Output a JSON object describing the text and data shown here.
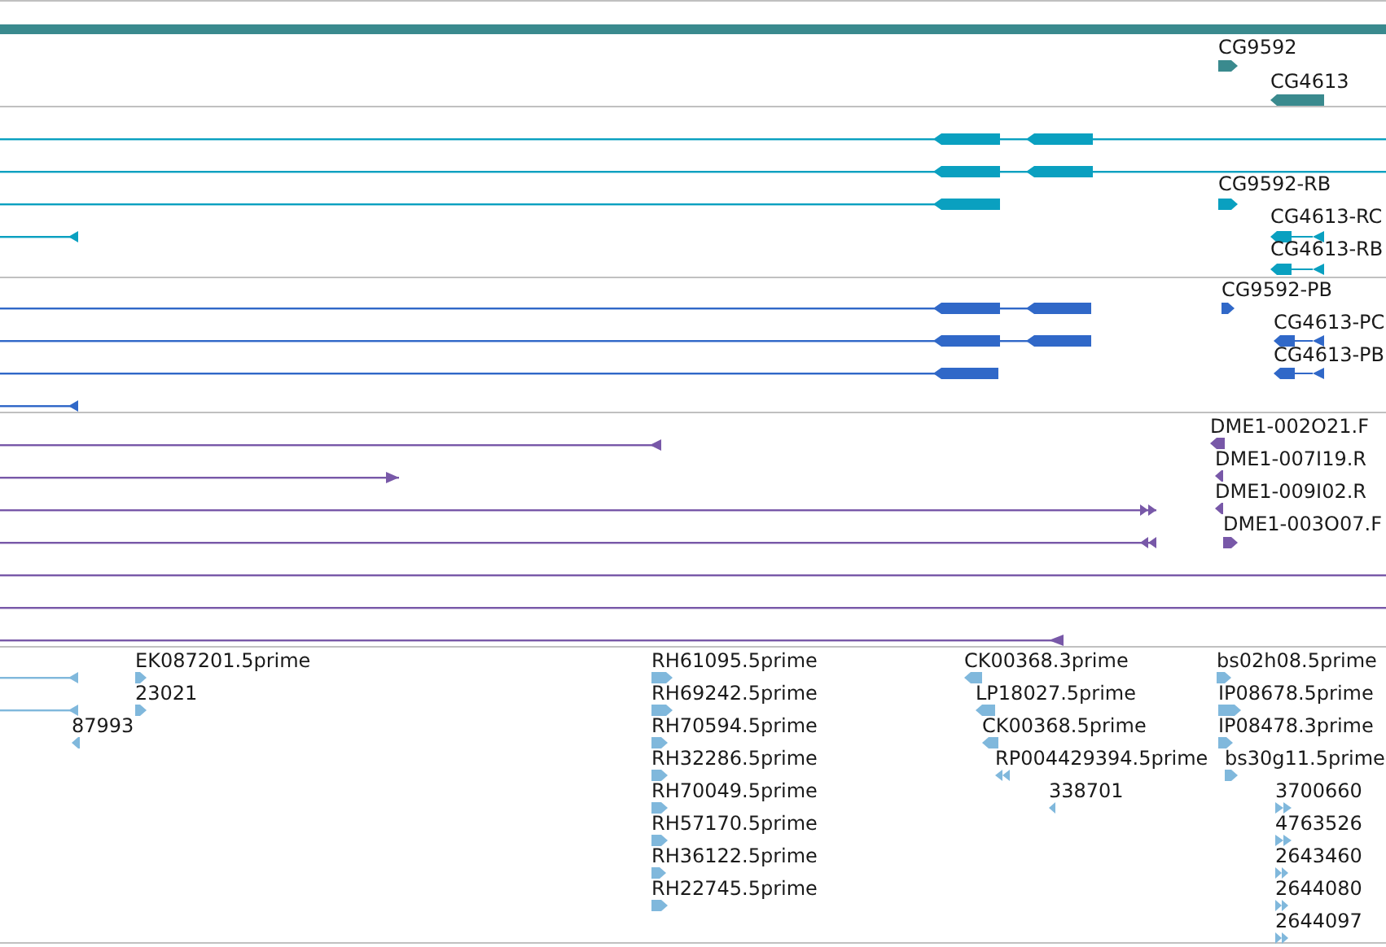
{
  "tracks": [
    {
      "color": "#3a8a8e",
      "features": [
        {
          "label": "CG9592",
          "forward": true
        },
        {
          "label": "CG4613",
          "forward": false
        }
      ]
    },
    {
      "color": "#0aa0c0",
      "features": [
        {
          "label": "CG9592-RB",
          "forward": true
        },
        {
          "label": "CG4613-RC",
          "forward": false
        },
        {
          "label": "CG4613-RB",
          "forward": false
        }
      ]
    },
    {
      "color": "#3068c8",
      "features": [
        {
          "label": "CG9592-PB",
          "forward": true
        },
        {
          "label": "CG4613-PC",
          "forward": false
        },
        {
          "label": "CG4613-PB",
          "forward": false
        }
      ]
    },
    {
      "color": "#7858a8",
      "features": [
        {
          "label": "DME1-002O21.F",
          "forward": false
        },
        {
          "label": "DME1-007I19.R",
          "forward": false
        },
        {
          "label": "DME1-009I02.R",
          "forward": false
        },
        {
          "label": "DME1-003O07.F",
          "forward": true
        }
      ]
    },
    {
      "color": "#80b8dc",
      "features": [
        {
          "label": "EK087201.5prime",
          "forward": true
        },
        {
          "label": "23021",
          "forward": true
        },
        {
          "label": "87993",
          "forward": false
        },
        {
          "label": "RH61095.5prime",
          "forward": true
        },
        {
          "label": "RH69242.5prime",
          "forward": true
        },
        {
          "label": "RH70594.5prime",
          "forward": true
        },
        {
          "label": "RH32286.5prime",
          "forward": true
        },
        {
          "label": "RH70049.5prime",
          "forward": true
        },
        {
          "label": "RH57170.5prime",
          "forward": true
        },
        {
          "label": "RH36122.5prime",
          "forward": true
        },
        {
          "label": "RH22745.5prime",
          "forward": true
        },
        {
          "label": "CK00368.3prime",
          "forward": false
        },
        {
          "label": "LP18027.5prime",
          "forward": false
        },
        {
          "label": "CK00368.5prime",
          "forward": false
        },
        {
          "label": "RP004429394.5prime",
          "forward": false
        },
        {
          "label": "338701",
          "forward": false
        },
        {
          "label": "bs02h08.5prime",
          "forward": true
        },
        {
          "label": "IP08678.5prime",
          "forward": true
        },
        {
          "label": "IP08478.3prime",
          "forward": true
        },
        {
          "label": "bs30g11.5prime",
          "forward": true
        },
        {
          "label": "3700660",
          "forward": true
        },
        {
          "label": "4763526",
          "forward": true
        },
        {
          "label": "2643460",
          "forward": true
        },
        {
          "label": "2644080",
          "forward": true
        },
        {
          "label": "2644097",
          "forward": true
        }
      ]
    }
  ]
}
